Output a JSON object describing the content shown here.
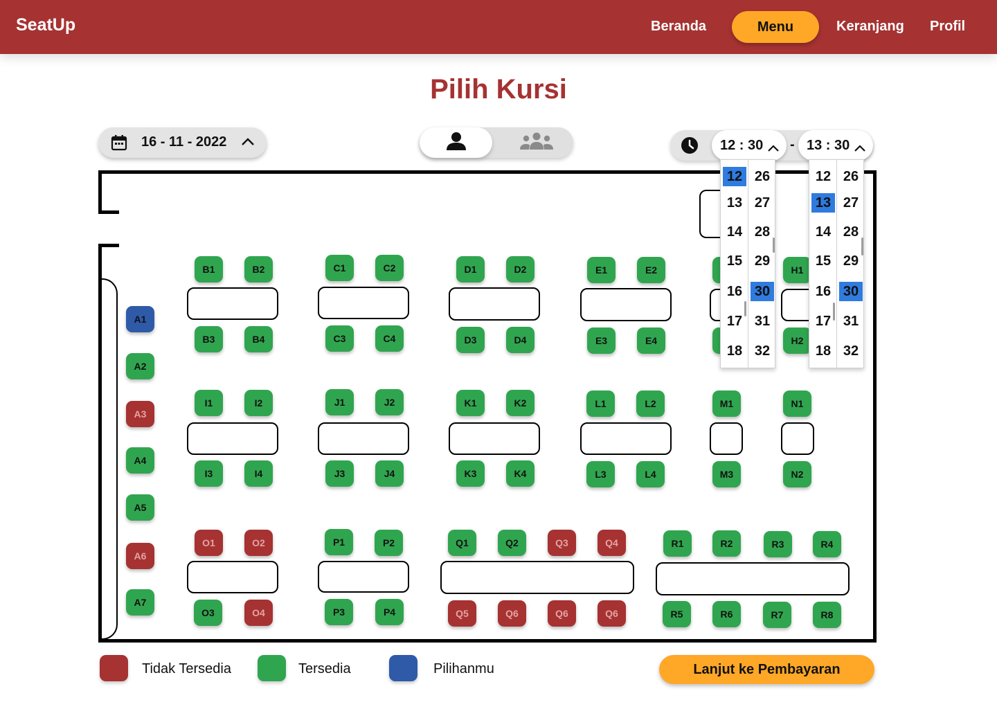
{
  "nav": {
    "brand": "SeatUp",
    "links": {
      "beranda": "Beranda",
      "menu": "Menu",
      "keranjang": "Keranjang",
      "profil": "Profil"
    }
  },
  "page": {
    "title": "Pilih Kursi"
  },
  "date_picker": {
    "value": "16 - 11 - 2022"
  },
  "time_range": {
    "start": "12 : 30",
    "separator": "-",
    "end": "13 : 30"
  },
  "dropdown_start": {
    "hours": [
      "12",
      "13",
      "14",
      "15",
      "16",
      "17",
      "18"
    ],
    "minutes": [
      "26",
      "27",
      "28",
      "29",
      "30",
      "31",
      "32"
    ],
    "selected_hour": "12",
    "selected_minute": "30"
  },
  "dropdown_end": {
    "hours": [
      "12",
      "13",
      "14",
      "15",
      "16",
      "17",
      "18"
    ],
    "minutes": [
      "26",
      "27",
      "28",
      "29",
      "30",
      "31",
      "32"
    ],
    "selected_hour": "13",
    "selected_minute": "30"
  },
  "seats": {
    "A1": "chosen",
    "A2": "avail",
    "A3": "unavail",
    "A4": "avail",
    "A5": "avail",
    "A6": "unavail",
    "A7": "avail",
    "B1": "avail",
    "B2": "avail",
    "B3": "avail",
    "B4": "avail",
    "C1": "avail",
    "C2": "avail",
    "C3": "avail",
    "C4": "avail",
    "D1": "avail",
    "D2": "avail",
    "D3": "avail",
    "D4": "avail",
    "E1": "avail",
    "E2": "avail",
    "E3": "avail",
    "E4": "avail",
    "H1": "avail",
    "H2": "avail",
    "I1": "avail",
    "I2": "avail",
    "I3": "avail",
    "I4": "avail",
    "J1": "avail",
    "J2": "avail",
    "J3": "avail",
    "J4": "avail",
    "K1": "avail",
    "K2": "avail",
    "K3": "avail",
    "K4": "avail",
    "L1": "avail",
    "L2": "avail",
    "L3": "avail",
    "L4": "avail",
    "M1": "avail",
    "M3": "avail",
    "N1": "avail",
    "N2": "avail",
    "O1": "unavail",
    "O2": "unavail",
    "O3": "avail",
    "O4": "unavail",
    "P1": "avail",
    "P2": "avail",
    "P3": "avail",
    "P4": "avail",
    "Q1": "avail",
    "Q2": "avail",
    "Q3": "unavail",
    "Q4": "unavail",
    "Q5": "unavail",
    "Q6a": "unavail",
    "Q6b": "unavail",
    "Q6c": "unavail",
    "R1": "avail",
    "R2": "avail",
    "R3": "avail",
    "R4": "avail",
    "R5": "avail",
    "R6": "avail",
    "R7": "avail",
    "R8": "avail"
  },
  "seat_labels": {
    "A1": "A1",
    "A2": "A2",
    "A3": "A3",
    "A4": "A4",
    "A5": "A5",
    "A6": "A6",
    "A7": "A7",
    "B1": "B1",
    "B2": "B2",
    "B3": "B3",
    "B4": "B4",
    "C1": "C1",
    "C2": "C2",
    "C3": "C3",
    "C4": "C4",
    "D1": "D1",
    "D2": "D2",
    "D3": "D3",
    "D4": "D4",
    "E1": "E1",
    "E2": "E2",
    "E3": "E3",
    "E4": "E4",
    "H1": "H1",
    "H2": "H2",
    "I1": "I1",
    "I2": "I2",
    "I3": "I3",
    "I4": "I4",
    "J1": "J1",
    "J2": "J2",
    "J3": "J3",
    "J4": "J4",
    "K1": "K1",
    "K2": "K2",
    "K3": "K3",
    "K4": "K4",
    "L1": "L1",
    "L2": "L2",
    "L3": "L3",
    "L4": "L4",
    "M1": "M1",
    "M3": "M3",
    "N1": "N1",
    "N2": "N2",
    "O1": "O1",
    "O2": "O2",
    "O3": "O3",
    "O4": "O4",
    "P1": "P1",
    "P2": "P2",
    "P3": "P3",
    "P4": "P4",
    "Q1": "Q1",
    "Q2": "Q2",
    "Q3": "Q3",
    "Q4": "Q4",
    "Q5": "Q5",
    "Q6a": "Q6",
    "Q6b": "Q6",
    "Q6c": "Q6",
    "R1": "R1",
    "R2": "R2",
    "R3": "R3",
    "R4": "R4",
    "R5": "R5",
    "R6": "R6",
    "R7": "R7",
    "R8": "R8"
  },
  "legend": {
    "unavailable": "Tidak Tersedia",
    "available": "Tersedia",
    "chosen": "Pilihanmu"
  },
  "colors": {
    "brand": "#a63232",
    "accent": "#ffa726",
    "available": "#30a54f",
    "unavailable": "#a63232",
    "chosen": "#2e5aa8",
    "selected_time": "#2f7be0"
  },
  "cta": {
    "label": "Lanjut ke Pembayaran"
  },
  "icons": {
    "date": "calendar-icon",
    "single": "person-icon",
    "group": "group-icon",
    "time": "clock-icon",
    "toggle": "chevron-up-icon"
  }
}
